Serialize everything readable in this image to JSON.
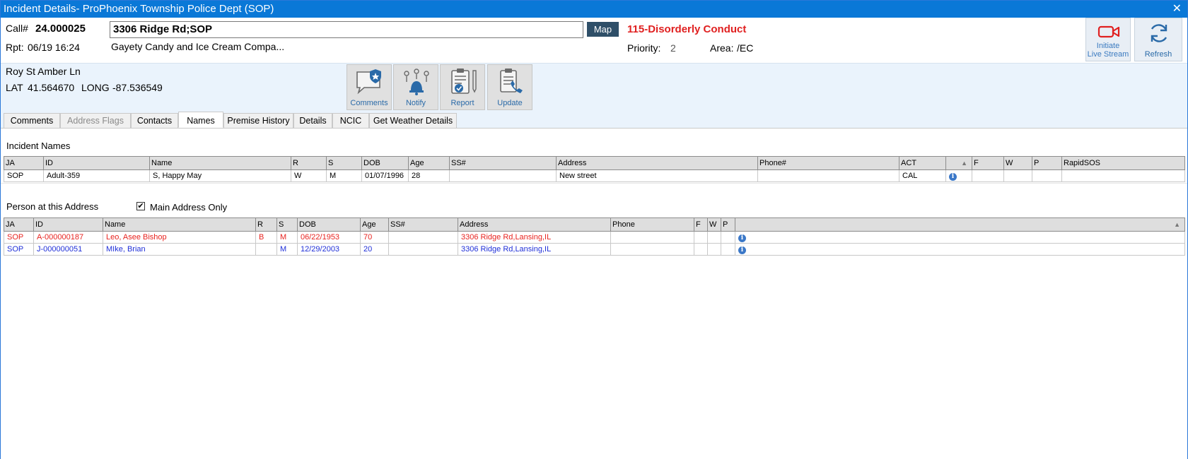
{
  "window": {
    "title": "Incident Details- ProPhoenix Township Police Dept (SOP)",
    "close_glyph": "✕"
  },
  "header": {
    "call_label": "Call#",
    "call_number": "24.000025",
    "address": "3306 Ridge Rd;SOP",
    "map_label": "Map",
    "nature": "115-Disorderly Conduct",
    "rpt_label": "Rpt:",
    "rpt_value": "06/19 16:24",
    "business": "Gayety Candy and Ice Cream Compa...",
    "priority_label": "Priority:",
    "priority_value": "2",
    "area_label": "Area:",
    "area_value": "/EC",
    "live_stream_line1": "Initiate",
    "live_stream_line2": "Live Stream",
    "refresh_label": "Refresh"
  },
  "location": {
    "cross_street": "Roy St  Amber Ln",
    "lat_label": "LAT",
    "lat": "41.564670",
    "long_label": "LONG",
    "long": "-87.536549"
  },
  "actions": {
    "comments": "Comments",
    "notify": "Notify",
    "report": "Report",
    "update": "Update"
  },
  "tabs": [
    "Comments",
    "Address Flags",
    "Contacts",
    "Names",
    "Premise History",
    "Details",
    "NCIC",
    "Get Weather Details"
  ],
  "active_tab": "Names",
  "incident_names": {
    "title": "Incident Names",
    "columns": [
      "JA",
      "ID",
      "Name",
      "R",
      "S",
      "DOB",
      "Age",
      "SS#",
      "Address",
      "Phone#",
      "ACT",
      "",
      "F",
      "W",
      "P",
      "RapidSOS"
    ],
    "rows": [
      [
        "SOP",
        "Adult-359",
        "S, Happy May",
        "W",
        "M",
        "01/07/1996",
        "28",
        "",
        "New street",
        "",
        "CAL",
        "",
        "",
        "",
        "",
        ""
      ]
    ]
  },
  "persons_at_address": {
    "title": "Person at this Address",
    "checkbox_label": "Main Address Only",
    "checkbox_checked": true,
    "checkmark": "✔",
    "columns": [
      "JA",
      "ID",
      "Name",
      "R",
      "S",
      "DOB",
      "Age",
      "SS#",
      "Address",
      "Phone",
      "F",
      "W",
      "P",
      ""
    ],
    "rows": [
      [
        "SOP",
        "A-000000187",
        "Leo, Asee Bishop",
        "B",
        "M",
        "06/22/1953",
        "70",
        "",
        "3306 Ridge Rd,Lansing,IL",
        "",
        "",
        "",
        "",
        ""
      ],
      [
        "SOP",
        "J-000000051",
        "MIke, Brian",
        "",
        "M",
        "12/29/2003",
        "20",
        "",
        "3306 Ridge Rd,Lansing,IL",
        "",
        "",
        "",
        "",
        ""
      ]
    ],
    "row_colors": [
      "#e8231f",
      "#1f2fd8"
    ]
  },
  "colors": {
    "titlebar": "#0a78d7",
    "nature": "#e02020",
    "accent_blue": "#2a6aa8"
  },
  "icons": {
    "info": "i",
    "sort": "▲"
  }
}
